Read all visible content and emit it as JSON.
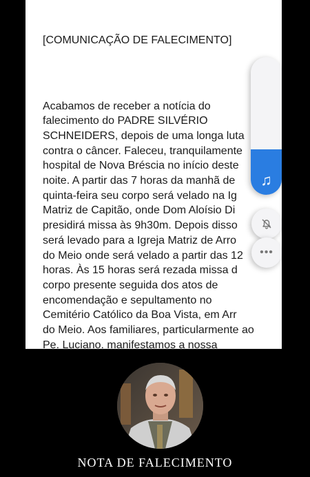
{
  "post": {
    "heading": "[COMUNICAÇÃO DE FALECIMENTO]",
    "body": "Acabamos de receber a notícia do\nfalecimento do PADRE SILVÉRIO\nSCHNEIDERS, depois de uma longa luta\ncontra o câncer. Faleceu, tranquilamente\nhospital de Nova Bréscia no início deste\nnoite. A partir das 7 horas da manhã de\nquinta-feira seu corpo será velado na Ig\nMatriz de Capitão, onde Dom Aloísio Di\npresidirá missa às 9h30m. Depois disso\nserá levado para a Igreja Matriz de Arro\ndo Meio onde será velado a partir das 12\nhoras. Às 15 horas será rezada missa d\ncorpo presente seguida dos atos de\nencomendação e sepultamento no\nCemitério Católico da Boa Vista, em Arr\ndo Meio. Aos familiares, particularmente ao\nPe. Luciano, manifestamos a nossa\nsolidariedade.\nPe. Silvério foi um grande padre e deixa um\ngrande vazio no presbitério da Diocese."
  },
  "media_controls": {
    "volume_level": 0.33,
    "music_icon": "music-note-icon",
    "mute_icon": "bell-off-icon",
    "more_icon": "more-dots-icon",
    "more_label": "•••"
  },
  "caption": "NOTA DE FALECIMENTO",
  "colors": {
    "accent": "#2a7de1",
    "background": "#000000",
    "card": "#ffffff"
  }
}
